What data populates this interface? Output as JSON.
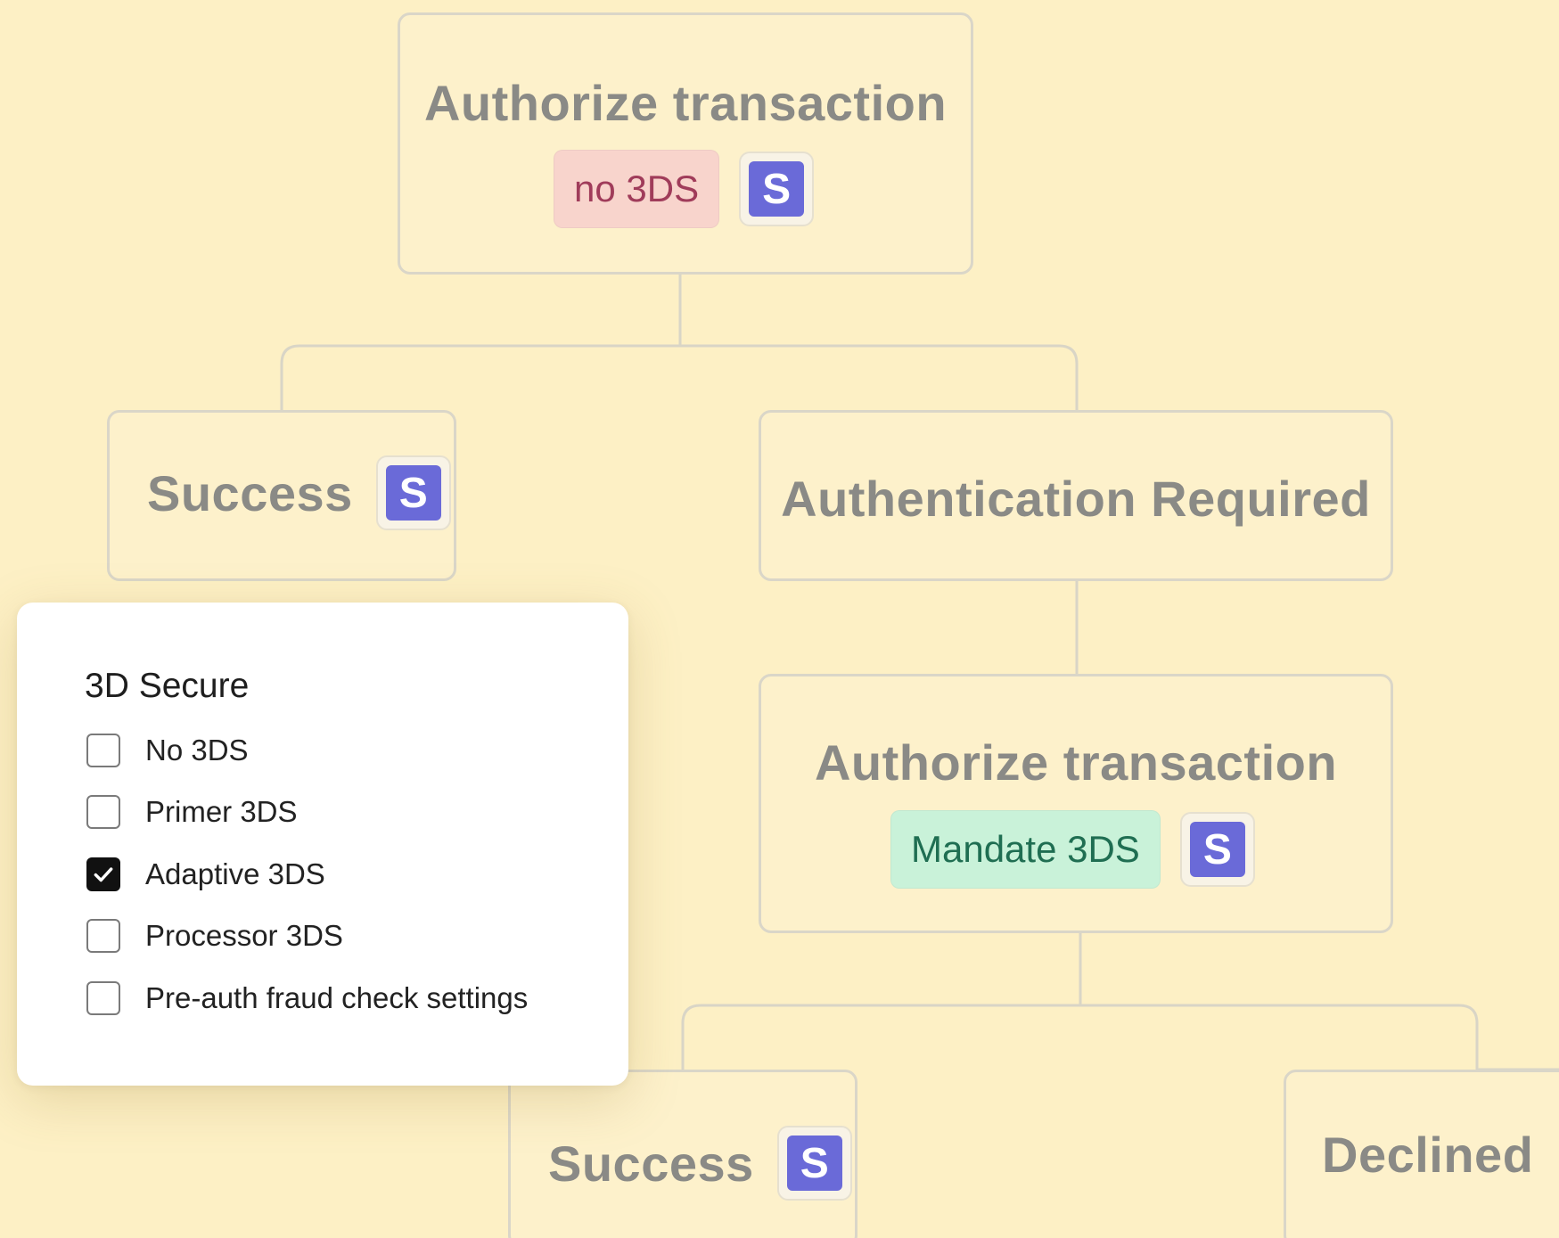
{
  "flow": {
    "auth_top": {
      "title": "Authorize transaction",
      "tag": "no 3DS",
      "badge": "S"
    },
    "success_top": {
      "title": "Success",
      "badge": "S"
    },
    "auth_required": {
      "title": "Authentication Required"
    },
    "auth_mid": {
      "title": "Authorize transaction",
      "tag": "Mandate 3DS",
      "badge": "S"
    },
    "success_bottom": {
      "title": "Success",
      "badge": "S"
    },
    "declined": {
      "title": "Declined"
    }
  },
  "popup": {
    "title": "3D Secure",
    "options": [
      {
        "label": "No 3DS",
        "checked": false
      },
      {
        "label": "Primer 3DS",
        "checked": false
      },
      {
        "label": "Adaptive 3DS",
        "checked": true
      },
      {
        "label": "Processor 3DS",
        "checked": false
      },
      {
        "label": "Pre-auth fraud check settings",
        "checked": false
      }
    ]
  },
  "colors": {
    "background": "#fdf0c5",
    "tag_red_bg": "#f8d4cc",
    "tag_red_text": "#a03c5a",
    "tag_green_bg": "#c9f2d9",
    "tag_green_text": "#1f6e52",
    "badge_accent": "#6a6ad8"
  },
  "icons": {
    "badge": "stripe-s-icon",
    "checkmark": "checkmark-icon"
  }
}
